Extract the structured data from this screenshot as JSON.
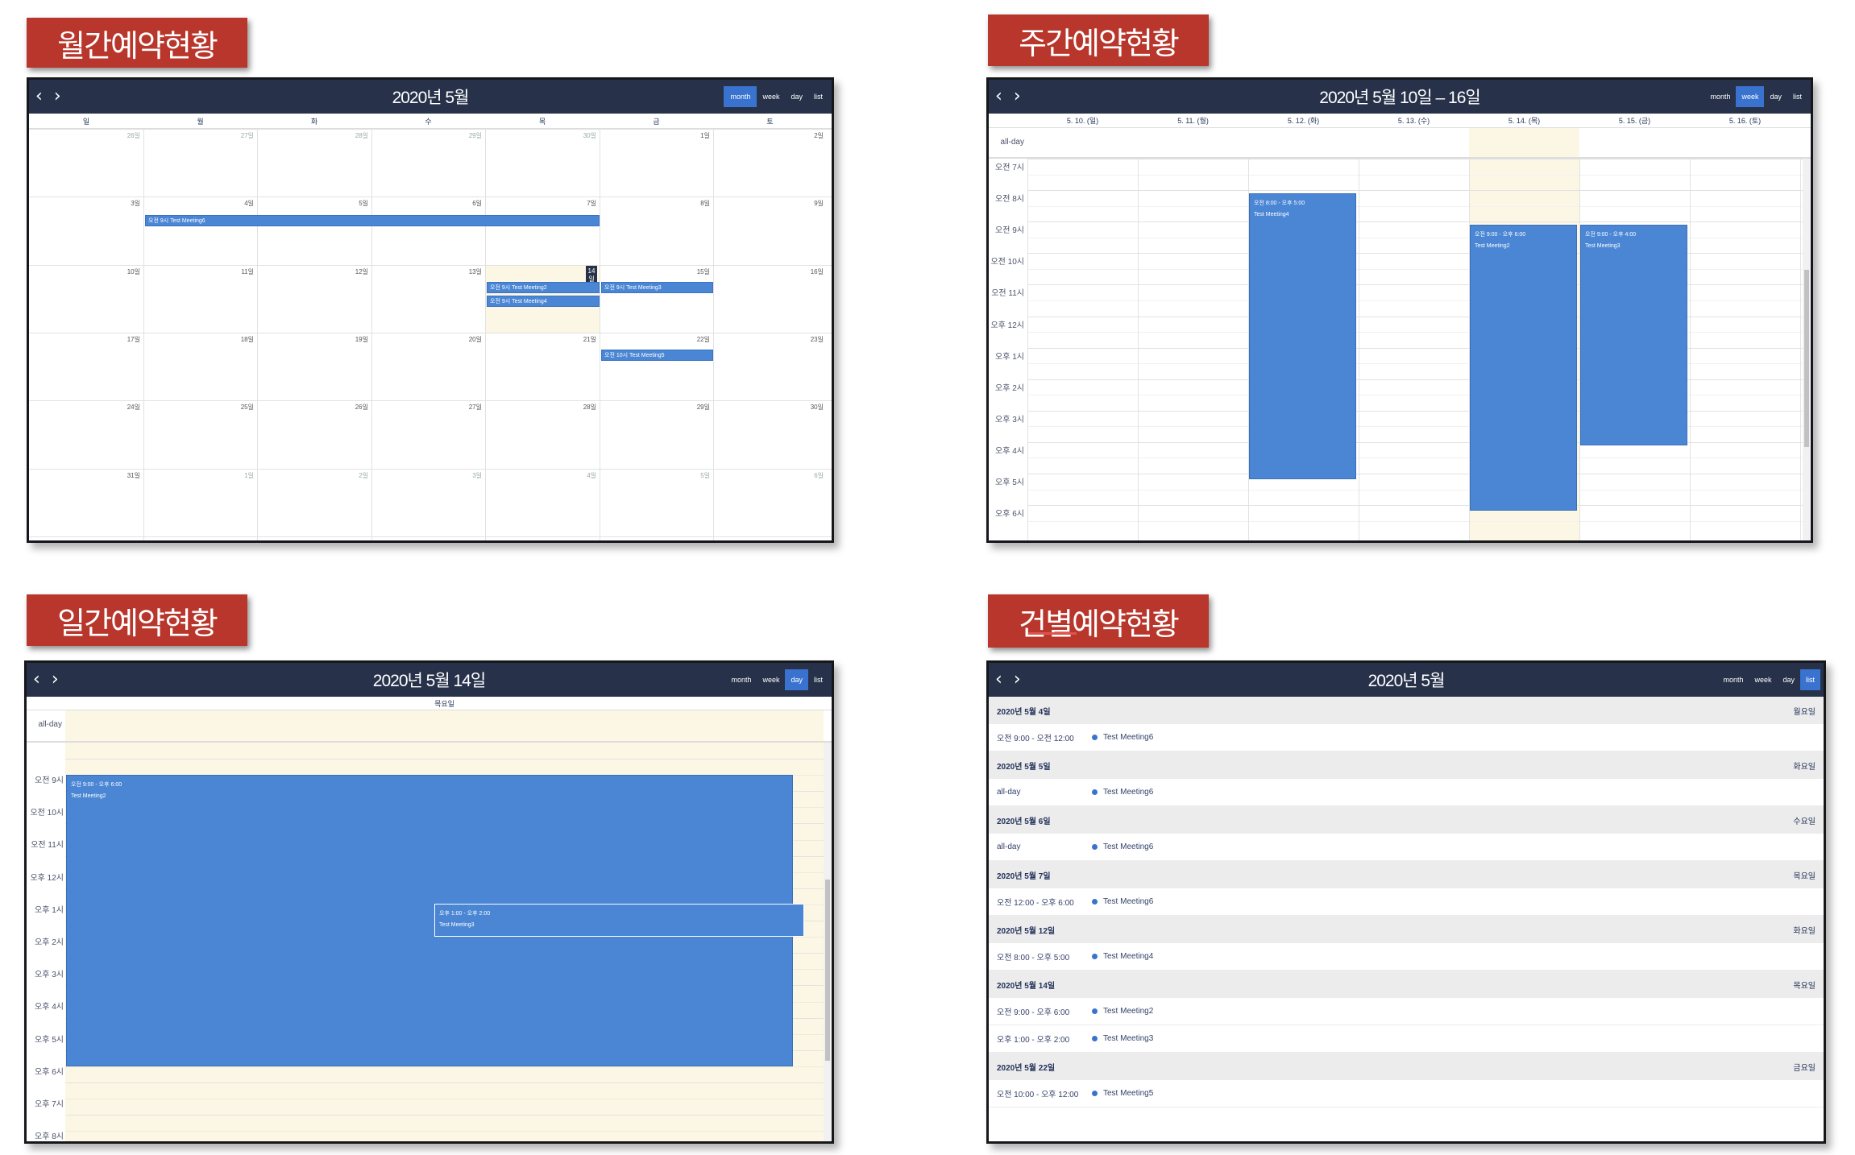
{
  "sections": {
    "monthly": "월간예약현황",
    "weekly": "주간예약현황",
    "daily": "일간예약현황",
    "item": "건별예약현황"
  },
  "nav": {
    "prev": "‹",
    "next": "›"
  },
  "views": {
    "month": "month",
    "week": "week",
    "day": "day",
    "list": "list"
  },
  "month_view": {
    "title": "2020년 5월",
    "weekdays": [
      "일",
      "월",
      "화",
      "수",
      "목",
      "금",
      "토"
    ],
    "weeks": [
      [
        "26일",
        "27일",
        "28일",
        "29일",
        "30일",
        "1일",
        "2일"
      ],
      [
        "3일",
        "4일",
        "5일",
        "6일",
        "7일",
        "8일",
        "9일"
      ],
      [
        "10일",
        "11일",
        "12일",
        "13일",
        "14일",
        "15일",
        "16일"
      ],
      [
        "17일",
        "18일",
        "19일",
        "20일",
        "21일",
        "22일",
        "23일"
      ],
      [
        "24일",
        "25일",
        "26일",
        "27일",
        "28일",
        "29일",
        "30일"
      ],
      [
        "31일",
        "1일",
        "2일",
        "3일",
        "4일",
        "5일",
        "6일"
      ]
    ],
    "events": {
      "meeting6": "오전 9시 Test Meeting6",
      "meeting2": "오전 9시 Test Meeting2",
      "meeting4": "오전 9시 Test Meeting4",
      "meeting3": "오전 9시 Test Meeting3",
      "meeting5": "오전 10시 Test Meeting5"
    }
  },
  "week_view": {
    "title": "2020년 5월 10일 – 16일",
    "days": [
      "5. 10. (일)",
      "5. 11. (월)",
      "5. 12. (화)",
      "5. 13. (수)",
      "5. 14. (목)",
      "5. 15. (금)",
      "5. 16. (토)"
    ],
    "allday": "all-day",
    "times": [
      "오전 7시",
      "오전 8시",
      "오전 9시",
      "오전 10시",
      "오전 11시",
      "오후 12시",
      "오후 1시",
      "오후 2시",
      "오후 3시",
      "오후 4시",
      "오후 5시",
      "오후 6시"
    ],
    "events": {
      "e4_time": "오전 8:00 - 오후 5:00",
      "e4_title": "Test Meeting4",
      "e2_time": "오전 9:00 - 오후 6:00",
      "e2_title": "Test Meeting2",
      "e3_time": "오전 9:00 - 오후 4:00",
      "e3_title": "Test Meeting3"
    }
  },
  "day_view": {
    "title": "2020년 5월 14일",
    "dow": "목요일",
    "allday": "all-day",
    "times": [
      "오전 9시",
      "오전 10시",
      "오전 11시",
      "오후 12시",
      "오후 1시",
      "오후 2시",
      "오후 3시",
      "오후 4시",
      "오후 5시",
      "오후 6시",
      "오후 7시",
      "오후 8시"
    ],
    "events": {
      "e2_time": "오전 9:00 - 오후 6:00",
      "e2_title": "Test Meeting2",
      "e3_time": "오후 1:00 - 오후 2:00",
      "e3_title": "Test Meeting3"
    }
  },
  "list_view": {
    "title": "2020년 5월",
    "groups": [
      {
        "date": "2020년 5월 4일",
        "dow": "월요일",
        "items": [
          {
            "time": "오전 9:00 - 오전 12:00",
            "title": "Test Meeting6"
          }
        ]
      },
      {
        "date": "2020년 5월 5일",
        "dow": "화요일",
        "items": [
          {
            "time": "all-day",
            "title": "Test Meeting6"
          }
        ]
      },
      {
        "date": "2020년 5월 6일",
        "dow": "수요일",
        "items": [
          {
            "time": "all-day",
            "title": "Test Meeting6"
          }
        ]
      },
      {
        "date": "2020년 5월 7일",
        "dow": "목요일",
        "items": [
          {
            "time": "오전 12:00 - 오후 6:00",
            "title": "Test Meeting6"
          }
        ]
      },
      {
        "date": "2020년 5월 12일",
        "dow": "화요일",
        "items": [
          {
            "time": "오전 8:00 - 오후 5:00",
            "title": "Test Meeting4"
          }
        ]
      },
      {
        "date": "2020년 5월 14일",
        "dow": "목요일",
        "items": [
          {
            "time": "오전 9:00 - 오후 6:00",
            "title": "Test Meeting2"
          },
          {
            "time": "오후 1:00 - 오후 2:00",
            "title": "Test Meeting3"
          }
        ]
      },
      {
        "date": "2020년 5월 22일",
        "dow": "금요일",
        "items": [
          {
            "time": "오전 10:00 - 오후 12:00",
            "title": "Test Meeting5"
          }
        ]
      }
    ]
  },
  "colors": {
    "header": "#27324a",
    "accent": "#3a73cf",
    "event": "#4a86d4",
    "today": "#fbf7e4",
    "tag": "#b8362b"
  }
}
